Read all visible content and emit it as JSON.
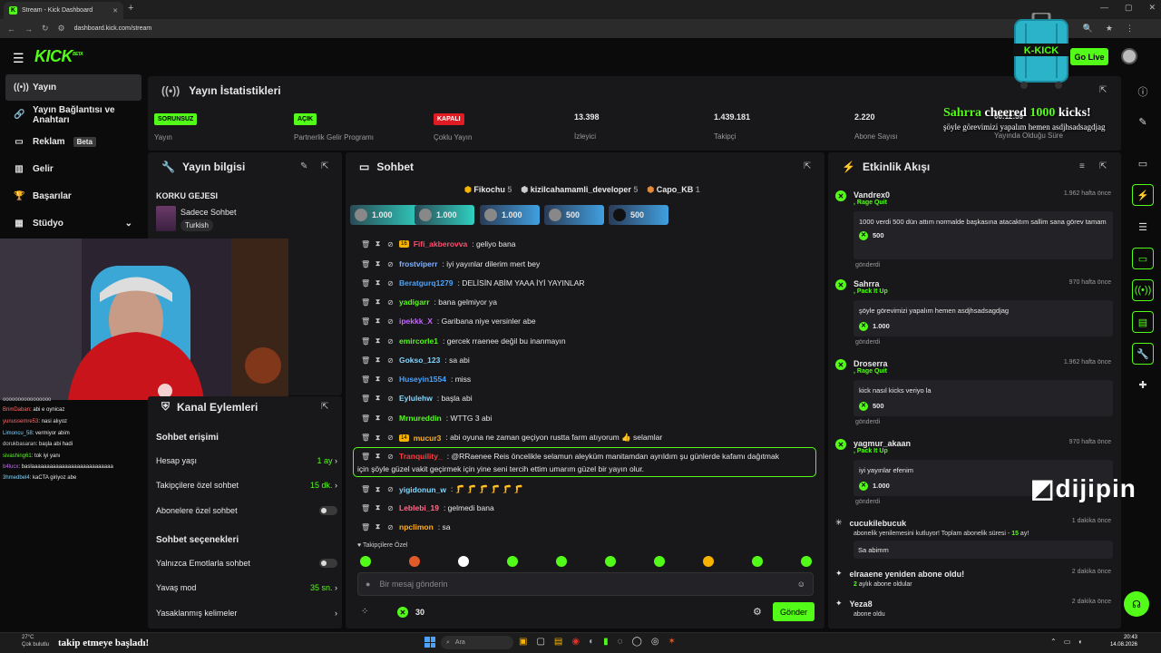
{
  "browser": {
    "tab_title": "Stream - Kick Dashboard",
    "url": "dashboard.kick.com/stream"
  },
  "header": {
    "logo": "KICK",
    "logo_sup": "BETA",
    "go_live": "Go Live"
  },
  "sidebar": {
    "items": [
      {
        "label": "Yayın"
      },
      {
        "label": "Yayın Bağlantısı ve Anahtarı"
      },
      {
        "label": "Reklam",
        "badge": "Beta"
      },
      {
        "label": "Gelir"
      },
      {
        "label": "Başarılar"
      },
      {
        "label": "Stüdyo"
      }
    ]
  },
  "stats": {
    "title": "Yayın İstatistikleri",
    "items": [
      {
        "badge": "SORUNSUZ",
        "label": "Yayın"
      },
      {
        "badge": "AÇIK",
        "label": "Partnerlik Gelir Programı"
      },
      {
        "badge": "KAPALI",
        "label": "Çoklu Yayın"
      },
      {
        "value": "13.398",
        "label": "İzleyici"
      },
      {
        "value": "1.439.181",
        "label": "Takipçi"
      },
      {
        "value": "2.220",
        "label": "Abone Sayısı"
      },
      {
        "value": "00:12:59",
        "label": "Yayında Olduğu Süre"
      }
    ]
  },
  "cheer": {
    "name": "Sahrra",
    "mid": "cheered",
    "amount": "1000",
    "unit": "kicks!",
    "message": "şöyle görevimizi yapalım hemen asdjhsadsagdjag"
  },
  "stream_info": {
    "title": "Yayın bilgisi",
    "stream_title": "KORKU GEJESI",
    "category": "Sadece Sohbet",
    "language": "Turkish"
  },
  "chat": {
    "title": "Sohbet",
    "top": [
      {
        "name": "Fikochu",
        "count": "5"
      },
      {
        "name": "kizilcahamamli_developer",
        "count": "5"
      },
      {
        "name": "Capo_KB",
        "count": "1"
      }
    ],
    "gifts": [
      "1.000",
      "1.000",
      "1.000",
      "500",
      "500"
    ],
    "messages": [
      {
        "user": "Fifi_akberovva",
        "color": "#ff4d6d",
        "text": ": geliyo bana",
        "badge": "16"
      },
      {
        "user": "frostviperr",
        "color": "#7fb0ff",
        "text": ": iyi yayınlar dilerim mert bey"
      },
      {
        "user": "Beratgurq1279",
        "color": "#4aa3ff",
        "text": ": DELİSİN ABİM YAAA İYİ YAYINLAR"
      },
      {
        "user": "yadigarr",
        "color": "#53fc18",
        "text": ": bana gelmiyor ya"
      },
      {
        "user": "ipekkk_X",
        "color": "#c864ff",
        "text": ": Garibana niye versinler abe"
      },
      {
        "user": "emircorle1",
        "color": "#53fc18",
        "text": ": gercek rraenee değil bu inanmayın"
      },
      {
        "user": "Gokso_123",
        "color": "#7fd6ff",
        "text": ": sa abi"
      },
      {
        "user": "Huseyin1554",
        "color": "#4aa3ff",
        "text": ": miss"
      },
      {
        "user": "Eylulehw",
        "color": "#7fd6ff",
        "text": ": başla abi"
      },
      {
        "user": "Mrnureddin",
        "color": "#53fc18",
        "text": ": WTTG 3 abi"
      },
      {
        "user": "mucur3",
        "color": "#ffb020",
        "text": ": abi oyuna ne zaman geçiyon rustta farm atıyorum 👍 selamlar",
        "badge": "14"
      },
      {
        "user": "yigidonun_w",
        "color": "#7fd6ff",
        "text": ": 🦵 🦵 🦵 🦵 🦵 🦵"
      },
      {
        "user": "Leblebi_19",
        "color": "#ff6d8a",
        "text": ": gelmedi bana"
      },
      {
        "user": "npclimon",
        "color": "#ffb020",
        "text": ": sa"
      }
    ],
    "highlight": {
      "user": "Tranquility_",
      "text": ": @RRaenee Reis öncelikle selamun aleyküm manitamdan ayrıldım şu günlerde kafamı dağıtmak",
      "text2": "için şöyle güzel vakit geçirmek için yine seni tercih ettim umarım güzel bir yayın olur."
    },
    "follower_only": "Takipçilere Özel",
    "placeholder": "Bir mesaj gönderin",
    "points": "30",
    "send": "Gönder"
  },
  "events": {
    "title": "Etkinlik Akışı",
    "items": [
      {
        "name": "Vandrex0",
        "sub": ", Rage Quit",
        "time": "1.962 hafta önce",
        "msg": "1000 verdi 500 dün attım normalde başkasına atacaktım sallim sana görev tamam",
        "amount": "500",
        "foot": "gönderdi"
      },
      {
        "name": "Sahrra",
        "sub": ", Pack It Up",
        "time": "970 hafta önce",
        "msg": "şöyle görevimizi yapalım hemen asdjhsadsagdjag",
        "amount": "1.000",
        "foot": "gönderdi"
      },
      {
        "name": "Droserra",
        "sub": ", Rage Quit",
        "time": "1.962 hafta önce",
        "msg": "kick nasıl kicks veriyo la",
        "amount": "500",
        "foot": "gönderdi"
      },
      {
        "name": "yagmur_akaan",
        "sub": ", Pack It Up",
        "time": "970 hafta önce",
        "msg": "iyi yayınlar efenim",
        "amount": "1.000",
        "foot": "gönderdi"
      }
    ],
    "sub_items": [
      {
        "name": "cucukilebucuk",
        "time": "1 dakika önce",
        "pre": "abonelik yenilemesini kutluyor! Toplam abonelik süresi - ",
        "months": "15",
        "post": " ay!",
        "msg": "Sa abimm"
      },
      {
        "name": "elraaene yeniden abone oldu!",
        "time": "2 dakika önce",
        "pre": "",
        "months": "2",
        "post": " aylık abone oldular"
      },
      {
        "name": "Yeza8",
        "time": "2 dakika önce",
        "pre": "abone oldu",
        "months": "",
        "post": ""
      }
    ]
  },
  "channel_actions": {
    "title": "Kanal Eylemleri",
    "section1": "Sohbet erişimi",
    "rows1": [
      {
        "label": "Hesap yaşı",
        "value": "1 ay"
      },
      {
        "label": "Takipçilere özel sohbet",
        "value": "15 dk."
      },
      {
        "label": "Abonelere özel sohbet",
        "value": ""
      }
    ],
    "section2": "Sohbet seçenekleri",
    "rows2": [
      {
        "label": "Yalnızca Emotlarla sohbet",
        "value": ""
      },
      {
        "label": "Yavaş mod",
        "value": "35 sn."
      },
      {
        "label": "Yasaklanmış kelimeler",
        "value": ""
      }
    ]
  },
  "overlay_chat": [
    {
      "user": "",
      "text": "oooooooooooooooo",
      "color": "#ccc"
    },
    {
      "user": "BrimDaban",
      "text": ": abi e oynicaz",
      "color": "#ff6d6d"
    },
    {
      "user": "yunussemre53",
      "text": ": nasi alıyoz",
      "color": "#ff6d6d"
    },
    {
      "user": "Limoncu_58",
      "text": ": vermiyor abim",
      "color": "#7fd6ff"
    },
    {
      "user": "dorukbasaran",
      "text": ": başla abi hadi",
      "color": "#ccc"
    },
    {
      "user": "sivashing61",
      "text": ": tok iyi yanı",
      "color": "#53fc18"
    },
    {
      "user": "b4lucx",
      "text": ": baslaaaaaaaaaaaaaaaaaaaaaaaaaaa",
      "color": "#c864ff"
    },
    {
      "user": "3hmedbel4",
      "text": ": kaCTA giriyoz abe",
      "color": "#7fd6ff"
    }
  ],
  "follow_alert": "takip etmeye başladı!",
  "taskbar": {
    "search": "Ara",
    "time": "20:43",
    "date": "14.08.2026",
    "weather": "27°C",
    "weather_desc": "Çok bulutlu"
  },
  "watermark": "dijipin",
  "colors": {
    "accent": "#53fc18",
    "panel": "#18181b",
    "bg": "#0b0b0c"
  }
}
